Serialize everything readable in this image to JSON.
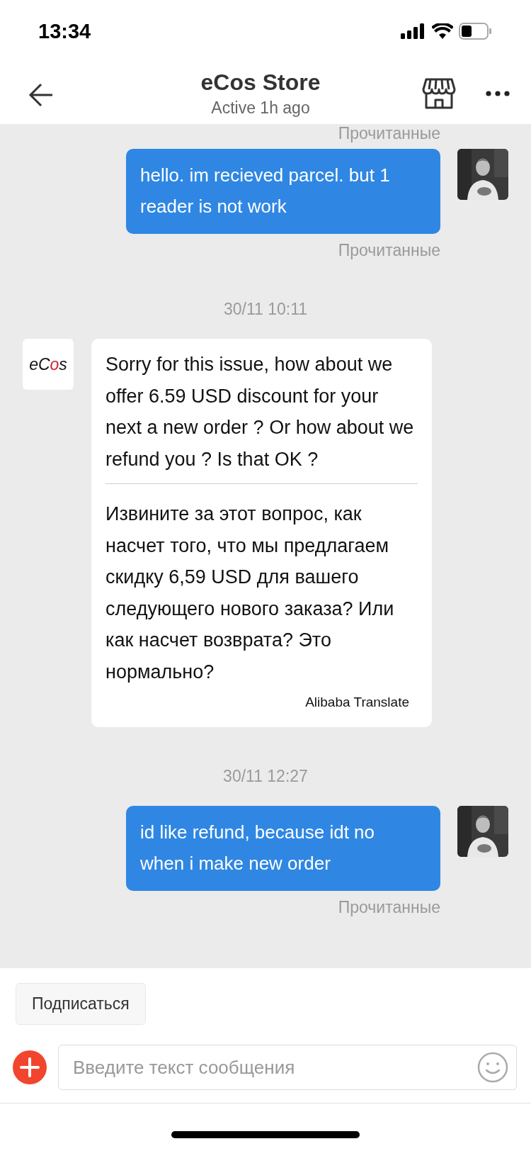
{
  "status_bar": {
    "time": "13:34"
  },
  "header": {
    "title": "eCos Store",
    "subtitle": "Active 1h ago"
  },
  "messages": [
    {
      "kind": "status",
      "text": "Прочитанные"
    },
    {
      "kind": "outgoing",
      "text": "hello. im recieved parcel. but 1 reader is not work"
    },
    {
      "kind": "status",
      "text": "Прочитанные"
    },
    {
      "kind": "date",
      "text": "30/11 10:11"
    },
    {
      "kind": "incoming",
      "sender_logo": "eCos",
      "text": "Sorry for this issue, how about we offer 6.59 USD discount for your next a new order ? Or how about we refund you ? Is that OK ?",
      "translation": "Извините за этот вопрос, как насчет того, что мы предлагаем скидку 6,59 USD для вашего следующего нового заказа? Или как насчет возврата? Это нормально?",
      "translator": "Alibaba Translate"
    },
    {
      "kind": "date",
      "text": "30/11 12:27"
    },
    {
      "kind": "outgoing",
      "text": "id like refund, because idt no when i make new order"
    },
    {
      "kind": "status",
      "text": "Прочитанные"
    }
  ],
  "subscribe_button": "Подписаться",
  "composer": {
    "placeholder": "Введите текст сообщения"
  }
}
